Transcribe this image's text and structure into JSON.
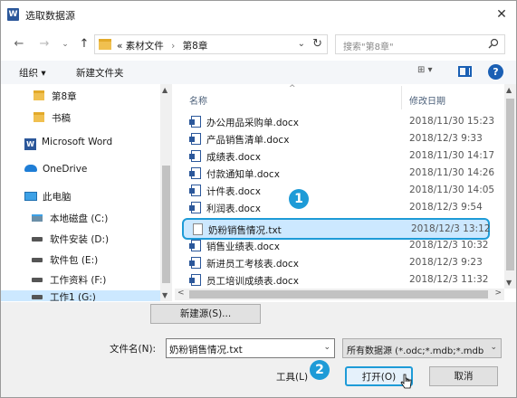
{
  "window": {
    "title": "选取数据源",
    "app_icon_letter": "W",
    "close_glyph": "✕"
  },
  "nav": {
    "back": "←",
    "forward": "→",
    "recent": "⌄",
    "up": "↑",
    "address_overflow": "«",
    "address_parts": [
      "素材文件",
      "第8章"
    ],
    "address_sep": "›",
    "refresh": "↻",
    "search_placeholder": "搜索\"第8章\""
  },
  "toolbar": {
    "organize": "组织 ▾",
    "new_folder": "新建文件夹",
    "view": "⊞ ▾",
    "help": "?"
  },
  "sidebar": {
    "items": [
      {
        "label": "第8章",
        "icon": "folder-icon"
      },
      {
        "label": "书稿",
        "icon": "folder-icon"
      },
      {
        "label": "Microsoft Word",
        "icon": "word-icon"
      },
      {
        "label": "OneDrive",
        "icon": "cloud-icon"
      },
      {
        "label": "此电脑",
        "icon": "computer-icon"
      },
      {
        "label": "本地磁盘 (C:)",
        "icon": "drive-icon"
      },
      {
        "label": "软件安装 (D:)",
        "icon": "drive-icon"
      },
      {
        "label": "软件包 (E:)",
        "icon": "drive-icon"
      },
      {
        "label": "工作资料 (F:)",
        "icon": "drive-icon"
      },
      {
        "label": "工作1 (G:)",
        "icon": "drive-icon"
      }
    ]
  },
  "file_list": {
    "col_name": "名称",
    "col_date": "修改日期",
    "rows": [
      {
        "name": "办公用品采购单.docx",
        "date": "2018/11/30 15:23",
        "type": "docx"
      },
      {
        "name": "产品销售清单.docx",
        "date": "2018/12/3 9:33",
        "type": "docx"
      },
      {
        "name": "成绩表.docx",
        "date": "2018/11/30 14:17",
        "type": "docx"
      },
      {
        "name": "付款通知单.docx",
        "date": "2018/11/30 14:26",
        "type": "docx"
      },
      {
        "name": "计件表.docx",
        "date": "2018/11/30 14:05",
        "type": "docx"
      },
      {
        "name": "利润表.docx",
        "date": "2018/12/3 9:54",
        "type": "docx"
      },
      {
        "name": "奶粉销售情况.txt",
        "date": "2018/12/3 13:12",
        "type": "txt",
        "selected": true
      },
      {
        "name": "销售业绩表.docx",
        "date": "2018/12/3 10:32",
        "type": "docx"
      },
      {
        "name": "新进员工考核表.docx",
        "date": "2018/12/3 9:23",
        "type": "docx"
      },
      {
        "name": "员工培训成绩表.docx",
        "date": "2018/12/3 11:32",
        "type": "docx"
      }
    ]
  },
  "badges": {
    "step1": "1",
    "step2": "2"
  },
  "footer": {
    "new_source": "新建源(S)...",
    "filename_label": "文件名(N):",
    "filename_value": "奶粉销售情况.txt",
    "filetype_value": "所有数据源 (*.odc;*.mdb;*.mdb",
    "tools": "工具(L)",
    "open": "打开(O)",
    "cancel": "取消"
  },
  "colors": {
    "accent": "#1e9bd7",
    "selection": "#cce8ff",
    "word_blue": "#2b579a"
  }
}
